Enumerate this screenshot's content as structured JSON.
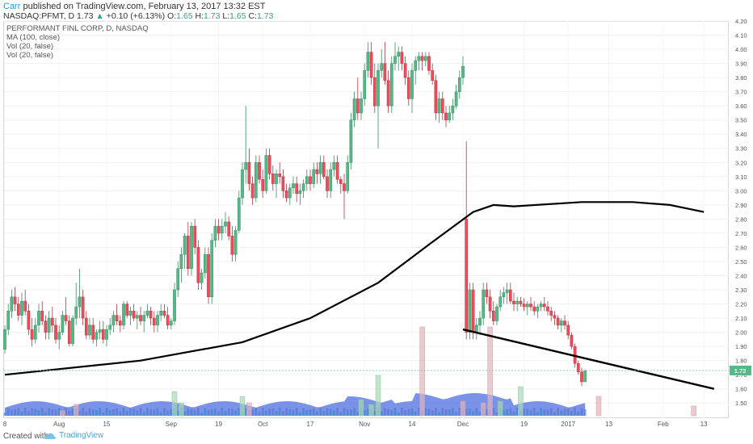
{
  "header": {
    "author": "Carr",
    "published_text": "published on TradingView.com, February 13, 2017 13:32 EST",
    "symbol": "NASDAQ:PFMT, D",
    "last": "1.73",
    "change_arrow": "▲",
    "change": "+0.10 (+6.13%)",
    "o_label": "O:",
    "o_value": "1.65",
    "h_label": "H:",
    "h_value": "1.73",
    "l_label": "L:",
    "l_value": "1.65",
    "c_label": "C:",
    "c_value": "1.73"
  },
  "legend": {
    "title": "PERFORMANT FINL CORP, D, NASDAQ",
    "ma": "MA (100, close)",
    "vol1": "Vol (20, false)",
    "vol2": "Vol (20, false)"
  },
  "price_badge": "1.73",
  "footer": {
    "created": "Created with",
    "brand": "TradingView"
  },
  "colors": {
    "up": "#26a69a",
    "down": "#ef5350",
    "up_candle": "#53b987",
    "down_candle": "#eb4d5c",
    "ma": "#000000",
    "volume_ma": "#4d6fe0",
    "price_line": "#7fc8a9"
  },
  "chart_data": {
    "type": "candlestick",
    "ylim": [
      1.45,
      4.2
    ],
    "y_ticks": [
      "1.50",
      "1.60",
      "1.70",
      "1.80",
      "1.90",
      "2.00",
      "2.10",
      "2.20",
      "2.30",
      "2.40",
      "2.50",
      "2.60",
      "2.70",
      "2.80",
      "2.90",
      "3.00",
      "3.10",
      "3.20",
      "3.30",
      "3.40",
      "3.50",
      "3.60",
      "3.70",
      "3.80",
      "3.90",
      "4.00",
      "4.10",
      "4.20"
    ],
    "x_ticks": [
      {
        "label": "8",
        "bar": 0
      },
      {
        "label": "Aug",
        "bar": 16
      },
      {
        "label": "15",
        "bar": 30
      },
      {
        "label": "Sep",
        "bar": 49
      },
      {
        "label": "19",
        "bar": 63
      },
      {
        "label": "Oct",
        "bar": 76
      },
      {
        "label": "17",
        "bar": 90
      },
      {
        "label": "Nov",
        "bar": 106
      },
      {
        "label": "14",
        "bar": 120
      },
      {
        "label": "Dec",
        "bar": 135
      },
      {
        "label": "19",
        "bar": 153
      },
      {
        "label": "2017",
        "bar": 166
      },
      {
        "label": "13",
        "bar": 178
      },
      {
        "label": "Feb",
        "bar": 194
      },
      {
        "label": "13",
        "bar": 206
      }
    ],
    "ohlc": [
      [
        1.88,
        2.05,
        1.85,
        2.02
      ],
      [
        2.02,
        2.2,
        1.98,
        2.15
      ],
      [
        2.15,
        2.3,
        2.1,
        2.25
      ],
      [
        2.25,
        2.32,
        2.15,
        2.2
      ],
      [
        2.2,
        2.25,
        2.08,
        2.12
      ],
      [
        2.12,
        2.28,
        2.05,
        2.22
      ],
      [
        2.22,
        2.3,
        2.12,
        2.15
      ],
      [
        2.15,
        2.2,
        1.98,
        2.02
      ],
      [
        2.02,
        2.1,
        1.9,
        1.95
      ],
      [
        1.95,
        2.1,
        1.92,
        2.05
      ],
      [
        2.05,
        2.2,
        2.0,
        2.15
      ],
      [
        2.15,
        2.22,
        2.05,
        2.08
      ],
      [
        2.08,
        2.12,
        1.95,
        2.0
      ],
      [
        2.0,
        2.15,
        1.95,
        2.1
      ],
      [
        2.1,
        2.18,
        2.0,
        2.05
      ],
      [
        2.05,
        2.1,
        1.92,
        1.95
      ],
      [
        1.95,
        2.05,
        1.88,
        2.0
      ],
      [
        2.0,
        2.15,
        1.98,
        2.12
      ],
      [
        2.12,
        2.25,
        2.05,
        2.08
      ],
      [
        2.08,
        2.12,
        1.9,
        1.92
      ],
      [
        1.92,
        2.12,
        1.9,
        2.1
      ],
      [
        2.1,
        2.35,
        2.05,
        2.18
      ],
      [
        2.18,
        2.45,
        2.1,
        2.25
      ],
      [
        2.25,
        2.3,
        2.05,
        2.1
      ],
      [
        2.1,
        2.15,
        1.95,
        1.98
      ],
      [
        1.98,
        2.1,
        1.95,
        2.05
      ],
      [
        2.05,
        2.1,
        1.92,
        1.95
      ],
      [
        1.95,
        2.02,
        1.9,
        2.0
      ],
      [
        2.0,
        2.08,
        1.95,
        2.02
      ],
      [
        2.02,
        2.08,
        1.92,
        1.95
      ],
      [
        1.95,
        2.05,
        1.9,
        2.02
      ],
      [
        2.02,
        2.1,
        1.98,
        2.05
      ],
      [
        2.05,
        2.15,
        2.0,
        2.12
      ],
      [
        2.12,
        2.2,
        2.05,
        2.08
      ],
      [
        2.08,
        2.12,
        2.0,
        2.05
      ],
      [
        2.05,
        2.22,
        2.02,
        2.2
      ],
      [
        2.2,
        2.22,
        2.1,
        2.12
      ],
      [
        2.12,
        2.18,
        2.05,
        2.15
      ],
      [
        2.15,
        2.2,
        2.08,
        2.1
      ],
      [
        2.1,
        2.15,
        2.02,
        2.12
      ],
      [
        2.12,
        2.18,
        2.05,
        2.08
      ],
      [
        2.08,
        2.15,
        2.0,
        2.12
      ],
      [
        2.12,
        2.2,
        2.1,
        2.15
      ],
      [
        2.15,
        2.18,
        2.05,
        2.1
      ],
      [
        2.1,
        2.15,
        2.0,
        2.05
      ],
      [
        2.05,
        2.15,
        2.0,
        2.12
      ],
      [
        2.12,
        2.2,
        2.08,
        2.15
      ],
      [
        2.15,
        2.2,
        2.1,
        2.12
      ],
      [
        2.12,
        2.18,
        2.02,
        2.05
      ],
      [
        2.05,
        2.1,
        2.02,
        2.08
      ],
      [
        2.08,
        2.35,
        2.05,
        2.3
      ],
      [
        2.3,
        2.5,
        2.25,
        2.45
      ],
      [
        2.45,
        2.6,
        2.35,
        2.55
      ],
      [
        2.55,
        2.7,
        2.45,
        2.68
      ],
      [
        2.68,
        2.78,
        2.4,
        2.45
      ],
      [
        2.45,
        2.78,
        2.4,
        2.75
      ],
      [
        2.75,
        2.8,
        2.55,
        2.6
      ],
      [
        2.6,
        2.65,
        2.3,
        2.35
      ],
      [
        2.35,
        2.45,
        2.3,
        2.42
      ],
      [
        2.42,
        2.6,
        2.38,
        2.55
      ],
      [
        2.55,
        2.6,
        2.2,
        2.25
      ],
      [
        2.25,
        2.7,
        2.2,
        2.65
      ],
      [
        2.65,
        2.8,
        2.6,
        2.75
      ],
      [
        2.75,
        2.8,
        2.65,
        2.7
      ],
      [
        2.7,
        2.8,
        2.65,
        2.75
      ],
      [
        2.75,
        2.85,
        2.7,
        2.78
      ],
      [
        2.78,
        2.82,
        2.65,
        2.68
      ],
      [
        2.68,
        2.75,
        2.5,
        2.55
      ],
      [
        2.55,
        2.75,
        2.5,
        2.72
      ],
      [
        2.72,
        3.0,
        2.7,
        2.95
      ],
      [
        2.95,
        3.2,
        2.9,
        3.15
      ],
      [
        3.15,
        3.6,
        3.05,
        3.2
      ],
      [
        3.2,
        3.3,
        3.0,
        3.05
      ],
      [
        3.05,
        3.1,
        2.9,
        2.95
      ],
      [
        2.95,
        3.25,
        2.92,
        3.2
      ],
      [
        3.2,
        3.25,
        3.05,
        3.08
      ],
      [
        3.08,
        3.15,
        2.95,
        3.0
      ],
      [
        3.0,
        3.3,
        2.98,
        3.25
      ],
      [
        3.25,
        3.3,
        3.08,
        3.12
      ],
      [
        3.12,
        3.18,
        3.0,
        3.05
      ],
      [
        3.05,
        3.15,
        2.95,
        3.12
      ],
      [
        3.12,
        3.2,
        3.05,
        3.1
      ],
      [
        3.1,
        3.15,
        2.95,
        3.0
      ],
      [
        3.0,
        3.05,
        2.92,
        2.95
      ],
      [
        2.95,
        3.05,
        2.9,
        3.02
      ],
      [
        3.02,
        3.1,
        2.98,
        3.05
      ],
      [
        3.05,
        3.1,
        2.92,
        2.98
      ],
      [
        2.98,
        3.05,
        2.9,
        3.0
      ],
      [
        3.0,
        3.08,
        2.95,
        3.05
      ],
      [
        3.05,
        3.15,
        3.0,
        3.1
      ],
      [
        3.1,
        3.15,
        3.0,
        3.05
      ],
      [
        3.05,
        3.2,
        3.02,
        3.15
      ],
      [
        3.15,
        3.2,
        3.05,
        3.12
      ],
      [
        3.12,
        3.25,
        3.05,
        3.2
      ],
      [
        3.2,
        3.25,
        3.08,
        3.1
      ],
      [
        3.1,
        3.15,
        2.95,
        3.0
      ],
      [
        3.0,
        3.2,
        2.95,
        3.15
      ],
      [
        3.15,
        3.25,
        3.1,
        3.2
      ],
      [
        3.2,
        3.25,
        3.05,
        3.08
      ],
      [
        3.08,
        3.1,
        2.98,
        3.05
      ],
      [
        3.05,
        3.12,
        2.8,
        3.0
      ],
      [
        3.0,
        3.25,
        2.98,
        3.2
      ],
      [
        3.2,
        3.55,
        3.15,
        3.5
      ],
      [
        3.5,
        3.7,
        3.45,
        3.65
      ],
      [
        3.65,
        3.8,
        3.5,
        3.55
      ],
      [
        3.55,
        3.7,
        3.5,
        3.65
      ],
      [
        3.65,
        3.9,
        3.6,
        3.85
      ],
      [
        3.85,
        4.05,
        3.8,
        3.98
      ],
      [
        3.98,
        4.05,
        3.75,
        3.8
      ],
      [
        3.8,
        3.9,
        3.55,
        3.6
      ],
      [
        3.6,
        3.9,
        3.3,
        3.85
      ],
      [
        3.85,
        4.0,
        3.8,
        3.9
      ],
      [
        3.9,
        4.05,
        3.75,
        3.78
      ],
      [
        3.78,
        3.85,
        3.55,
        3.6
      ],
      [
        3.6,
        3.95,
        3.55,
        3.9
      ],
      [
        3.9,
        4.05,
        3.85,
        3.95
      ],
      [
        3.95,
        4.02,
        3.85,
        3.98
      ],
      [
        3.98,
        4.02,
        3.85,
        3.9
      ],
      [
        3.9,
        3.95,
        3.75,
        3.8
      ],
      [
        3.8,
        3.85,
        3.6,
        3.65
      ],
      [
        3.65,
        3.9,
        3.55,
        3.85
      ],
      [
        3.85,
        3.95,
        3.75,
        3.92
      ],
      [
        3.92,
        3.98,
        3.85,
        3.95
      ],
      [
        3.95,
        3.98,
        3.85,
        3.92
      ],
      [
        3.92,
        3.98,
        3.88,
        3.95
      ],
      [
        3.95,
        3.98,
        3.82,
        3.85
      ],
      [
        3.85,
        3.9,
        3.75,
        3.78
      ],
      [
        3.78,
        3.82,
        3.5,
        3.55
      ],
      [
        3.55,
        3.7,
        3.48,
        3.65
      ],
      [
        3.65,
        3.7,
        3.5,
        3.55
      ],
      [
        3.55,
        3.6,
        3.45,
        3.5
      ],
      [
        3.5,
        3.6,
        3.48,
        3.55
      ],
      [
        3.55,
        3.65,
        3.5,
        3.6
      ],
      [
        3.6,
        3.75,
        3.58,
        3.7
      ],
      [
        3.7,
        3.85,
        3.65,
        3.8
      ],
      [
        3.8,
        3.95,
        3.75,
        3.88
      ],
      [
        2.8,
        3.35,
        1.95,
        2.0
      ],
      [
        2.0,
        2.35,
        1.95,
        2.3
      ],
      [
        2.3,
        2.35,
        1.95,
        2.0
      ],
      [
        2.0,
        2.1,
        1.95,
        2.05
      ],
      [
        2.05,
        2.15,
        1.98,
        2.1
      ],
      [
        2.1,
        2.35,
        2.05,
        2.3
      ],
      [
        2.3,
        2.35,
        2.2,
        2.25
      ],
      [
        2.25,
        2.3,
        2.1,
        2.15
      ],
      [
        2.15,
        2.22,
        2.05,
        2.08
      ],
      [
        2.08,
        2.2,
        2.05,
        2.18
      ],
      [
        2.18,
        2.3,
        2.15,
        2.25
      ],
      [
        2.25,
        2.32,
        2.2,
        2.28
      ],
      [
        2.28,
        2.35,
        2.2,
        2.3
      ],
      [
        2.3,
        2.35,
        2.2,
        2.22
      ],
      [
        2.22,
        2.28,
        2.15,
        2.2
      ],
      [
        2.2,
        2.25,
        2.15,
        2.22
      ],
      [
        2.22,
        2.25,
        2.18,
        2.2
      ],
      [
        2.2,
        2.24,
        2.15,
        2.18
      ],
      [
        2.18,
        2.22,
        2.12,
        2.2
      ],
      [
        2.2,
        2.25,
        2.15,
        2.18
      ],
      [
        2.18,
        2.22,
        2.12,
        2.15
      ],
      [
        2.15,
        2.2,
        2.1,
        2.18
      ],
      [
        2.18,
        2.22,
        2.15,
        2.2
      ],
      [
        2.2,
        2.25,
        2.15,
        2.18
      ],
      [
        2.18,
        2.22,
        2.12,
        2.15
      ],
      [
        2.15,
        2.18,
        2.08,
        2.12
      ],
      [
        2.12,
        2.15,
        2.05,
        2.1
      ],
      [
        2.1,
        2.12,
        2.02,
        2.05
      ],
      [
        2.05,
        2.1,
        2.0,
        2.08
      ],
      [
        2.08,
        2.12,
        2.02,
        2.05
      ],
      [
        2.05,
        2.08,
        1.95,
        1.98
      ],
      [
        1.98,
        2.0,
        1.88,
        1.9
      ],
      [
        1.9,
        1.92,
        1.75,
        1.78
      ],
      [
        1.78,
        1.8,
        1.7,
        1.72
      ],
      [
        1.72,
        1.75,
        1.62,
        1.65
      ],
      [
        1.65,
        1.73,
        1.65,
        1.73
      ]
    ],
    "ma_line": [
      [
        0,
        1.7
      ],
      [
        40,
        1.8
      ],
      [
        70,
        1.93
      ],
      [
        90,
        2.1
      ],
      [
        110,
        2.35
      ],
      [
        125,
        2.62
      ],
      [
        138,
        2.85
      ],
      [
        144,
        2.9
      ],
      [
        150,
        2.89
      ],
      [
        170,
        2.92
      ],
      [
        185,
        2.92
      ],
      [
        196,
        2.9
      ],
      [
        206,
        2.85
      ]
    ],
    "trendline": [
      [
        2.02,
        135
      ],
      [
        1.6,
        209
      ]
    ],
    "volume_bars": [
      {
        "bar": 17,
        "height": 6,
        "up": false
      },
      {
        "bar": 21,
        "height": 14,
        "up": false
      },
      {
        "bar": 50,
        "height": 30,
        "up": true
      },
      {
        "bar": 52,
        "height": 16,
        "up": true
      },
      {
        "bar": 70,
        "height": 24,
        "up": true
      },
      {
        "bar": 72,
        "height": 16,
        "up": false
      },
      {
        "bar": 105,
        "height": 20,
        "up": true
      },
      {
        "bar": 108,
        "height": 14,
        "up": true
      },
      {
        "bar": 110,
        "height": 50,
        "up": true
      },
      {
        "bar": 123,
        "height": 110,
        "up": false
      },
      {
        "bar": 135,
        "height": 18,
        "up": false
      },
      {
        "bar": 141,
        "height": 16,
        "up": false
      },
      {
        "bar": 143,
        "height": 110,
        "up": false
      },
      {
        "bar": 146,
        "height": 18,
        "up": true
      },
      {
        "bar": 152,
        "height": 36,
        "up": true
      },
      {
        "bar": 175,
        "height": 24,
        "up": false
      },
      {
        "bar": 203,
        "height": 12,
        "up": false
      }
    ]
  }
}
